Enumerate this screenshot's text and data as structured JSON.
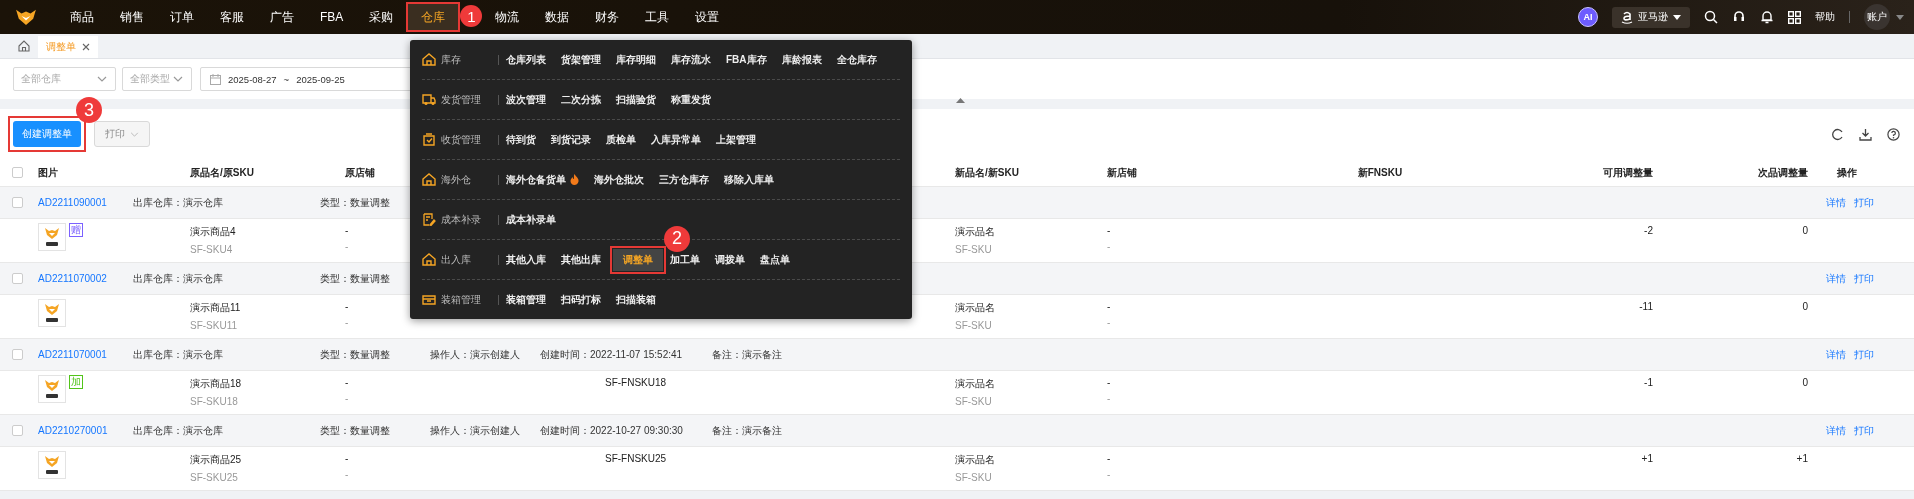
{
  "nav": {
    "items": [
      {
        "label": "商品",
        "selected": false
      },
      {
        "label": "销售",
        "selected": false
      },
      {
        "label": "订单",
        "selected": false
      },
      {
        "label": "客服",
        "selected": false
      },
      {
        "label": "广告",
        "selected": false
      },
      {
        "label": "FBA",
        "selected": false
      },
      {
        "label": "采购",
        "selected": false
      },
      {
        "label": "仓库",
        "selected": true,
        "annotation": "1"
      },
      {
        "label": "物流",
        "selected": false
      },
      {
        "label": "数据",
        "selected": false
      },
      {
        "label": "财务",
        "selected": false
      },
      {
        "label": "工具",
        "selected": false
      },
      {
        "label": "设置",
        "selected": false
      }
    ],
    "ai_badge": "AI",
    "platform": "亚马逊",
    "help": "帮助",
    "account": "账户"
  },
  "tabs": [
    {
      "label": "调整单",
      "selected": true
    }
  ],
  "filters": [
    {
      "kind": "select",
      "placeholder": "全部仓库"
    },
    {
      "kind": "select",
      "placeholder": "全部类型"
    },
    {
      "kind": "date",
      "start": "2025-08-27",
      "separator": "~",
      "end": "2025-09-25"
    }
  ],
  "toolbar": {
    "create": {
      "label": "创建调整单",
      "annotation": "3"
    },
    "print": {
      "label": "打印",
      "disabled": true
    }
  },
  "table": {
    "header_checked": false,
    "columns": [
      "图片",
      "原品名/原SKU",
      "原店铺",
      "新品名/新SKU",
      "新店铺",
      "新FNSKU",
      "可用调整量",
      "次品调整量",
      "操作"
    ],
    "groups": [
      {
        "checked": false,
        "order_no": "AD2211090001",
        "warehouse": "出库仓库：演示仓库",
        "type": "类型：数量调整",
        "actions": [
          "详情",
          "打印"
        ],
        "item": {
          "tag": {
            "text": "赠",
            "color": "#7b61ff"
          },
          "name": "演示商品4",
          "sku": "SF-SKU4",
          "shop": "-",
          "shop_sub": "-",
          "new_name": "演示品名",
          "new_sku": "SF-SKU",
          "new_shop": "-",
          "new_shop_sub": "-",
          "available": "-2",
          "defective": "0"
        }
      },
      {
        "checked": false,
        "order_no": "AD2211070002",
        "warehouse": "出库仓库：演示仓库",
        "type": "类型：数量调整",
        "actions": [
          "详情",
          "打印"
        ],
        "item": {
          "name": "演示商品11",
          "sku": "SF-SKU11",
          "shop": "-",
          "shop_sub": "-",
          "new_name": "演示品名",
          "new_sku": "SF-SKU",
          "new_shop": "-",
          "new_shop_sub": "-",
          "available": "-11",
          "defective": "0"
        }
      },
      {
        "checked": false,
        "order_no": "AD2211070001",
        "warehouse": "出库仓库：演示仓库",
        "type": "类型：数量调整",
        "operator": "操作人：演示创建人",
        "created": "创建时间：2022-11-07 15:52:41",
        "note": "备注：演示备注",
        "actions": [
          "详情",
          "打印"
        ],
        "item": {
          "tag": {
            "text": "加",
            "color": "#52c41a"
          },
          "name": "演示商品18",
          "sku": "SF-SKU18",
          "shop": "-",
          "shop_sub": "-",
          "fnsku": "SF-FNSKU18",
          "new_name": "演示品名",
          "new_sku": "SF-SKU",
          "new_shop": "-",
          "new_shop_sub": "-",
          "available": "-1",
          "defective": "0"
        }
      },
      {
        "checked": false,
        "order_no": "AD2210270001",
        "warehouse": "出库仓库：演示仓库",
        "type": "类型：数量调整",
        "operator": "操作人：演示创建人",
        "created": "创建时间：2022-10-27 09:30:30",
        "note": "备注：演示备注",
        "actions": [
          "详情",
          "打印"
        ],
        "item": {
          "name": "演示商品25",
          "sku": "SF-SKU25",
          "shop": "-",
          "shop_sub": "-",
          "fnsku": "SF-FNSKU25",
          "new_name": "演示品名",
          "new_sku": "SF-SKU",
          "new_shop": "-",
          "new_shop_sub": "-",
          "available": "+1",
          "defective": "+1"
        }
      }
    ]
  },
  "menu": {
    "categories": [
      {
        "kind": "stock",
        "label": "库存",
        "items": [
          {
            "label": "仓库列表",
            "selected": false
          },
          {
            "label": "货架管理",
            "selected": false
          },
          {
            "label": "库存明细",
            "selected": false
          },
          {
            "label": "库存流水",
            "selected": false
          },
          {
            "label": "FBA库存",
            "selected": false
          },
          {
            "label": "库龄报表",
            "selected": false
          },
          {
            "label": "全仓库存",
            "selected": false
          }
        ]
      },
      {
        "kind": "ship",
        "label": "发货管理",
        "items": [
          {
            "label": "波次管理",
            "selected": false
          },
          {
            "label": "二次分拣",
            "selected": false
          },
          {
            "label": "扫描验货",
            "selected": false
          },
          {
            "label": "称重发货",
            "selected": false
          }
        ]
      },
      {
        "kind": "receive",
        "label": "收货管理",
        "items": [
          {
            "label": "待到货",
            "selected": false
          },
          {
            "label": "到货记录",
            "selected": false
          },
          {
            "label": "质检单",
            "selected": false
          },
          {
            "label": "入库异常单",
            "selected": false
          },
          {
            "label": "上架管理",
            "selected": false
          }
        ]
      },
      {
        "kind": "overseas",
        "label": "海外仓",
        "items": [
          {
            "label": "海外仓备货单",
            "selected": false,
            "hot": true
          },
          {
            "label": "海外仓批次",
            "selected": false
          },
          {
            "label": "三方仓库存",
            "selected": false
          },
          {
            "label": "移除入库单",
            "selected": false
          }
        ]
      },
      {
        "kind": "cost",
        "label": "成本补录",
        "items": [
          {
            "label": "成本补录单",
            "selected": false
          }
        ]
      },
      {
        "kind": "inout",
        "label": "出入库",
        "items": [
          {
            "label": "其他入库",
            "selected": false
          },
          {
            "label": "其他出库",
            "selected": false
          },
          {
            "label": "调整单",
            "selected": true,
            "annotation": "2"
          },
          {
            "label": "加工单",
            "selected": false
          },
          {
            "label": "调拨单",
            "selected": false
          },
          {
            "label": "盘点单",
            "selected": false
          }
        ]
      },
      {
        "kind": "box",
        "label": "装箱管理",
        "items": [
          {
            "label": "装箱管理",
            "selected": false
          },
          {
            "label": "扫码打标",
            "selected": false
          },
          {
            "label": "扫描装箱",
            "selected": false
          }
        ]
      }
    ]
  }
}
